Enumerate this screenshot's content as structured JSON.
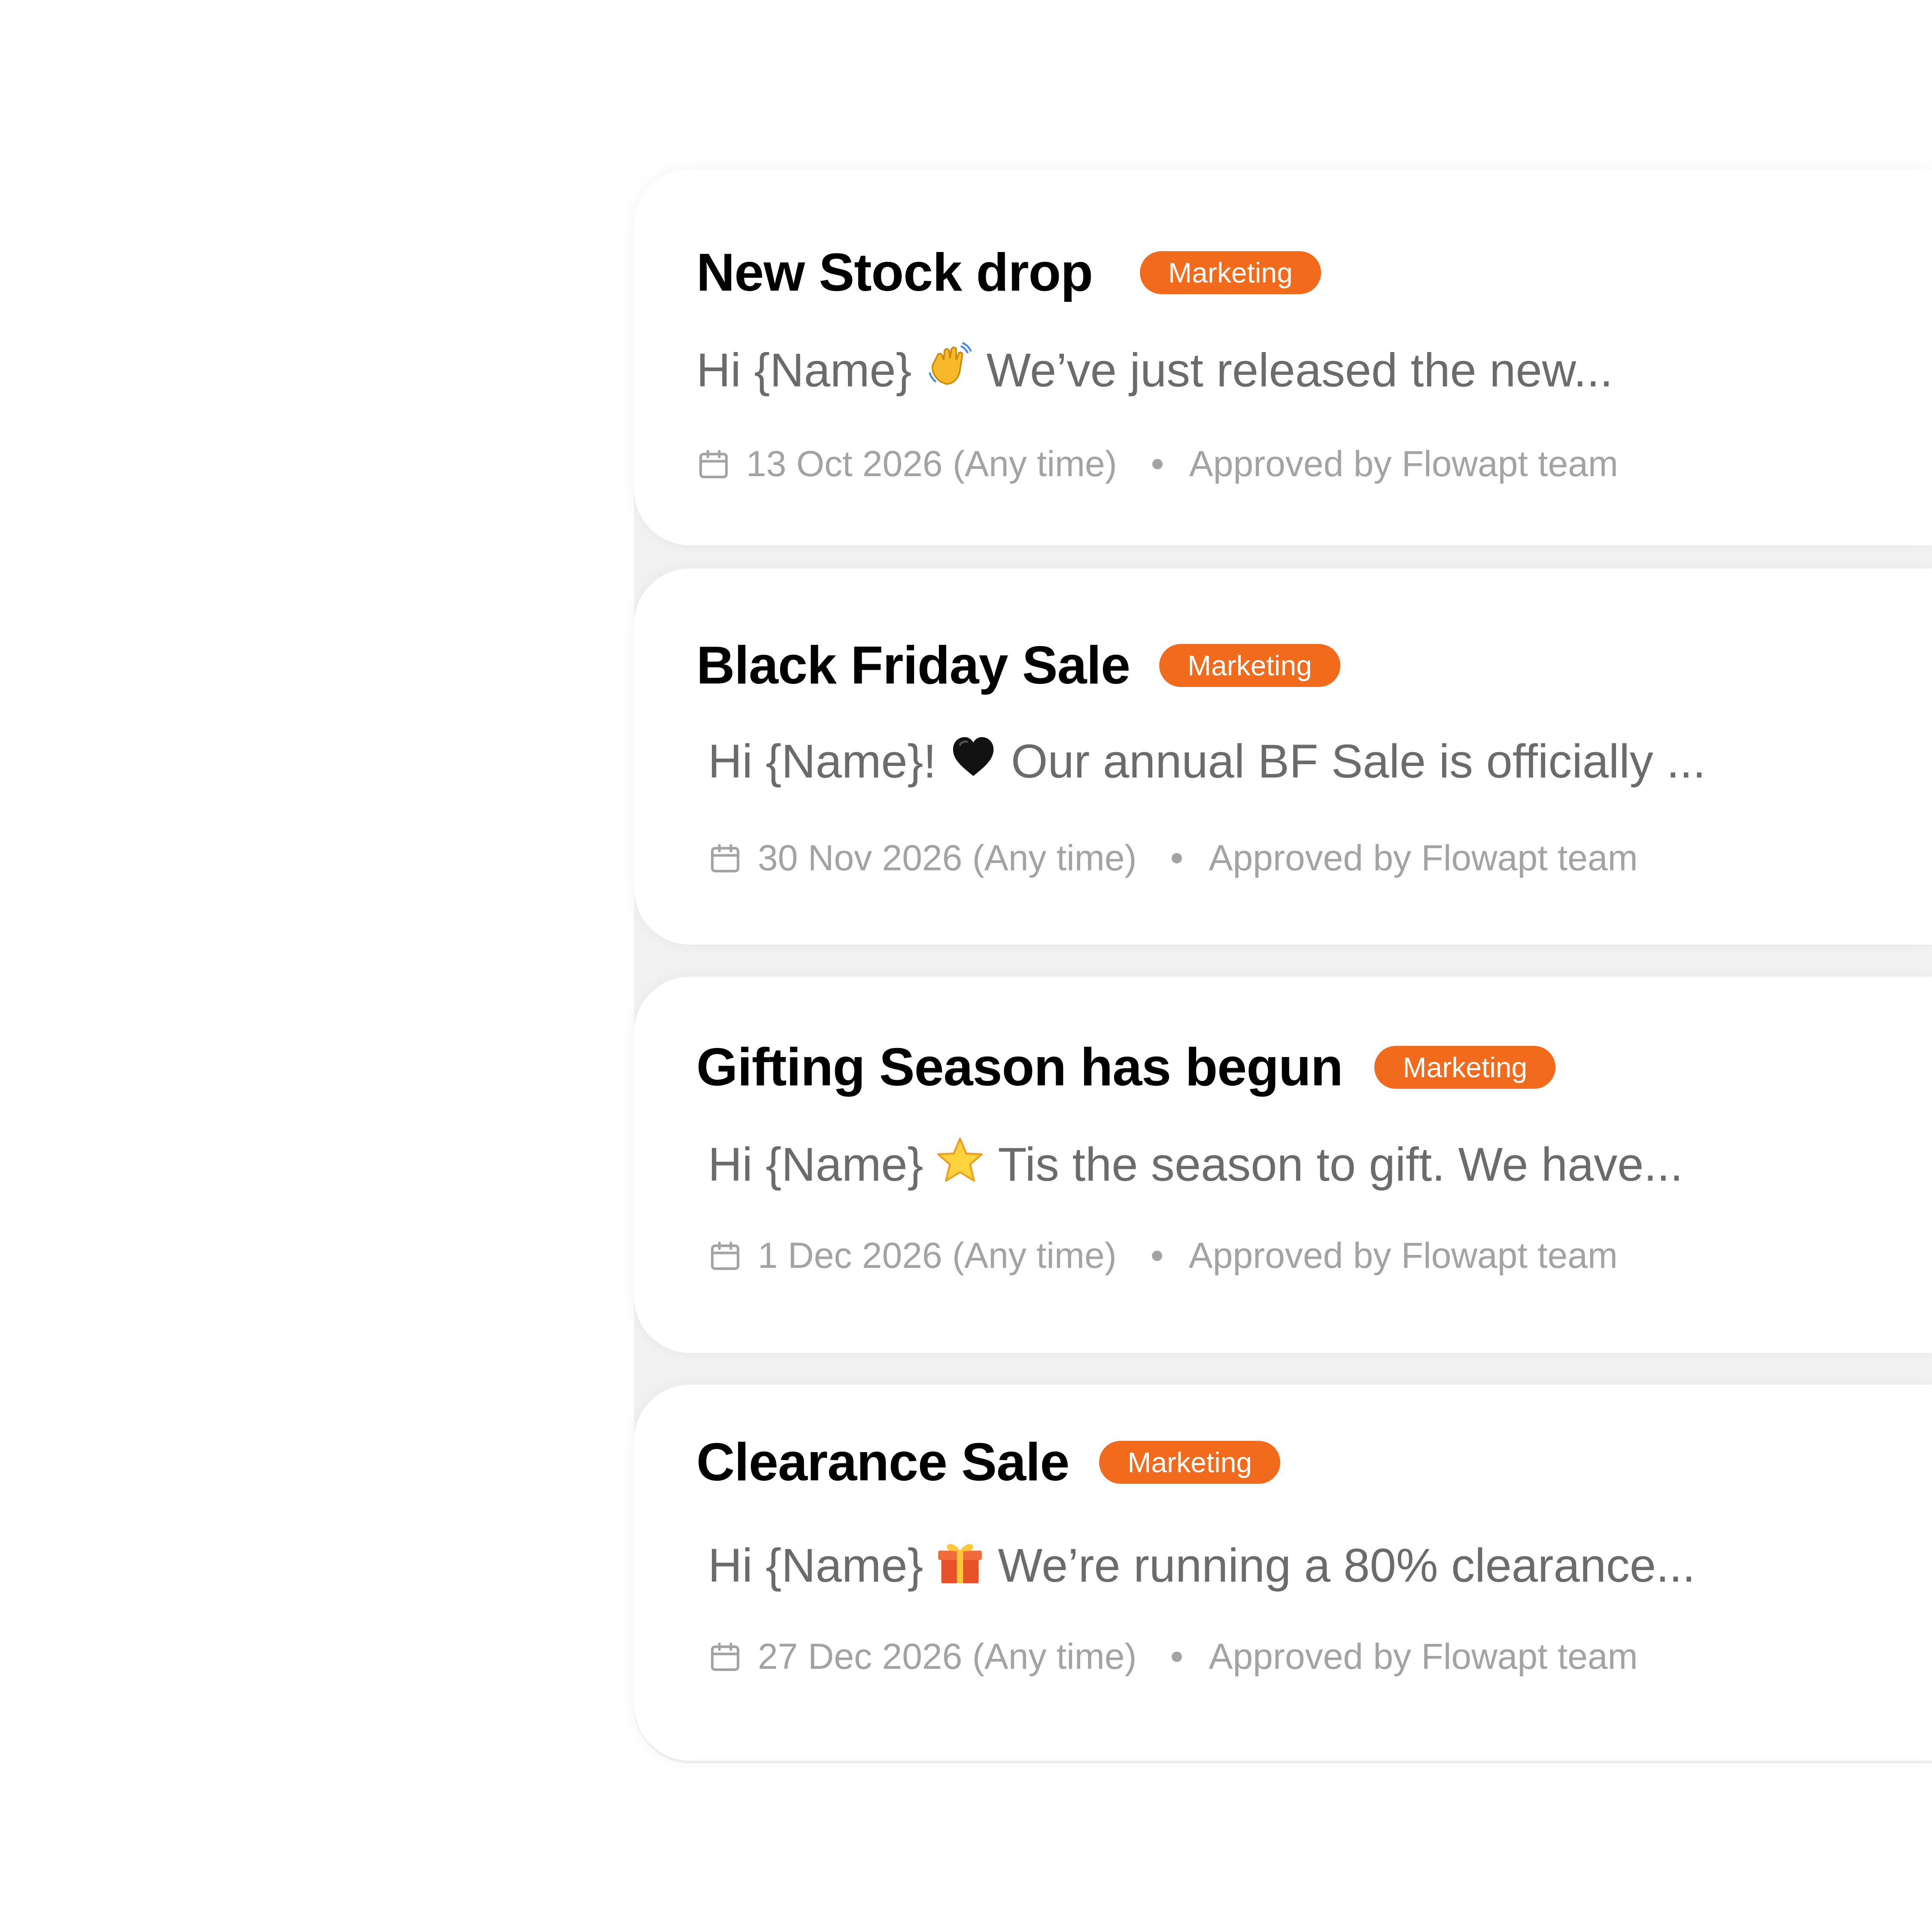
{
  "colors": {
    "badge": "#f26b1d",
    "title": "#000000",
    "preview": "#6b6b6b",
    "meta": "#a3a3a3"
  },
  "cards": [
    {
      "title": "New Stock drop",
      "badge": "Marketing",
      "preview_greeting": "Hi {Name}",
      "preview_emoji": "waving-hand-emoji",
      "preview_text": "We’ve just released the new...",
      "date": "13 Oct 2026 (Any time)",
      "approval": "Approved by Flowapt team"
    },
    {
      "title": "Black Friday Sale",
      "badge": "Marketing",
      "preview_greeting": "Hi {Name}!",
      "preview_emoji": "black-heart-emoji",
      "preview_text": "Our annual BF Sale is officially ...",
      "date": "30 Nov 2026 (Any time)",
      "approval": "Approved by Flowapt team"
    },
    {
      "title": "Gifting Season has begun",
      "badge": "Marketing",
      "preview_greeting": "Hi {Name}",
      "preview_emoji": "star-emoji",
      "preview_text": "Tis the season to gift. We have...",
      "date": "1 Dec 2026 (Any time)",
      "approval": "Approved by Flowapt team"
    },
    {
      "title": "Clearance Sale",
      "badge": "Marketing",
      "preview_greeting": "Hi {Name}",
      "preview_emoji": "gift-emoji",
      "preview_text": "We’re running a 80% clearance...",
      "date": "27 Dec 2026 (Any time)",
      "approval": "Approved by Flowapt team"
    }
  ]
}
